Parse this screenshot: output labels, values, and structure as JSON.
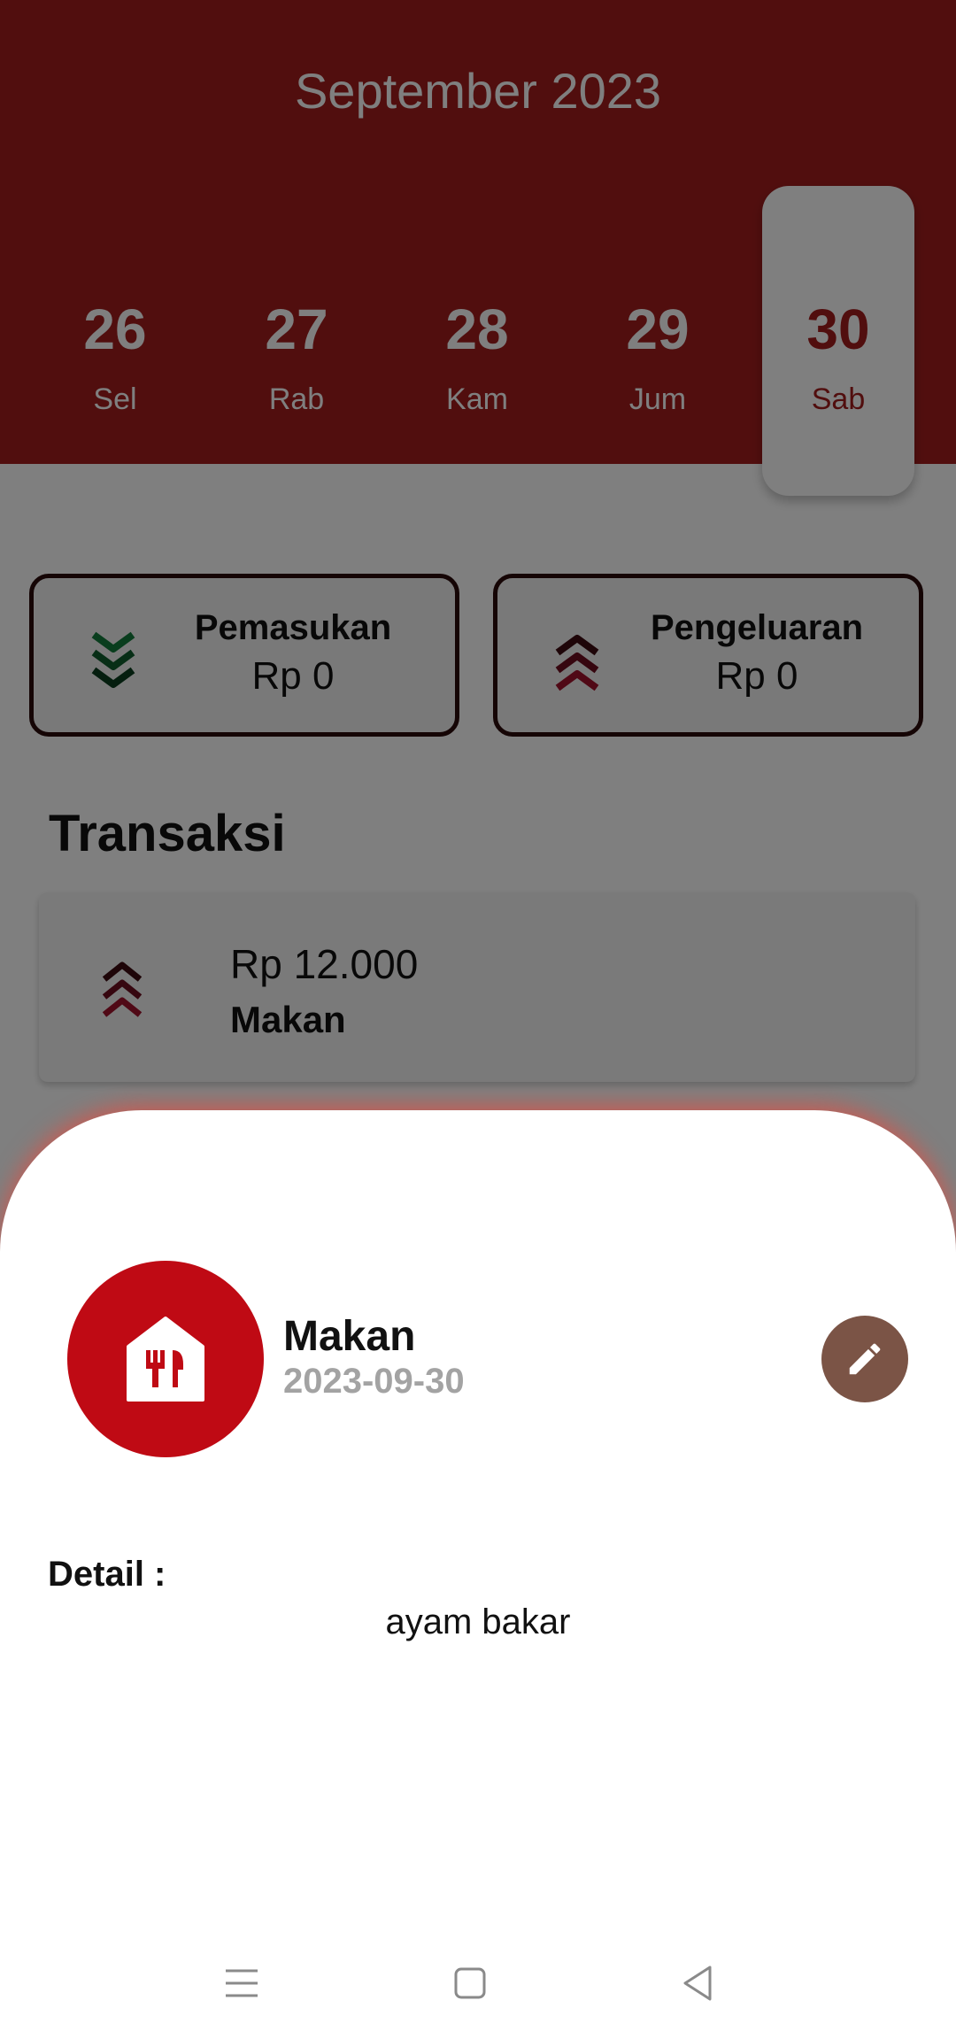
{
  "header": {
    "month": "September 2023"
  },
  "days": [
    {
      "num": "26",
      "name": "Sel"
    },
    {
      "num": "27",
      "name": "Rab"
    },
    {
      "num": "28",
      "name": "Kam"
    },
    {
      "num": "29",
      "name": "Jum"
    },
    {
      "num": "30",
      "name": "Sab"
    }
  ],
  "selected_day": "30",
  "summary": {
    "income": {
      "label": "Pemasukan",
      "amount": "Rp 0",
      "icon": "chevrons-down-icon"
    },
    "expense": {
      "label": "Pengeluaran",
      "amount": "Rp 0",
      "icon": "chevrons-up-icon"
    }
  },
  "transactions_title": "Transaksi",
  "transactions": [
    {
      "amount": "Rp 12.000",
      "category": "Makan",
      "type_icon": "chevrons-up-icon"
    }
  ],
  "sheet": {
    "category": "Makan",
    "date": "2023-09-30",
    "category_icon": "restaurant-icon",
    "edit_icon": "pencil-icon",
    "detail_label": "Detail :",
    "detail_text": "ayam bakar"
  },
  "colors": {
    "primary": "#a31d1d",
    "category_circle": "#bf0a14",
    "edit_button": "#7b5446",
    "income": "#137a3a",
    "expense": "#8a0f2a"
  },
  "navbar": {
    "icons": [
      "menu-icon",
      "home-square-icon",
      "back-triangle-icon"
    ]
  }
}
